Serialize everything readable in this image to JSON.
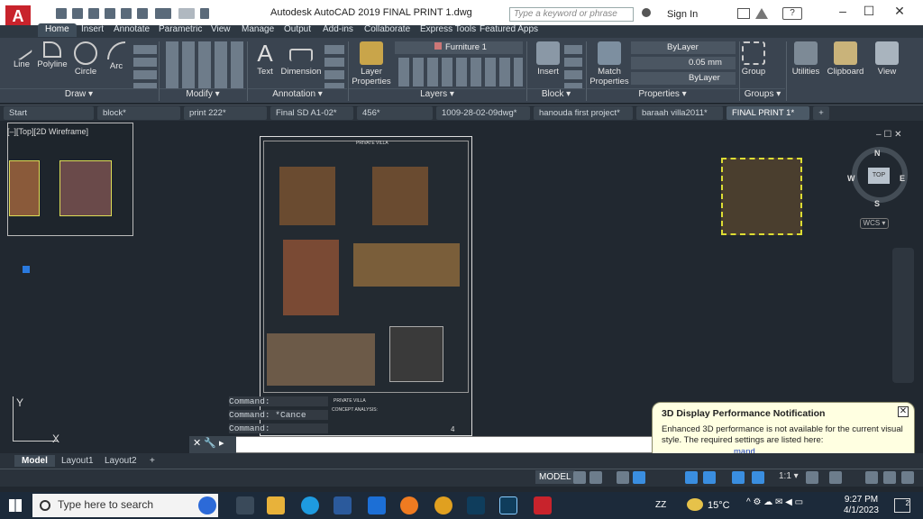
{
  "app": {
    "logo_letter": "A",
    "title": "Autodesk AutoCAD 2019    FINAL PRINT 1.dwg"
  },
  "search": {
    "placeholder": "Type a keyword or phrase"
  },
  "signin": {
    "label": "Sign In"
  },
  "window": {
    "min": "–",
    "max": "☐",
    "close": "✕"
  },
  "ribbon_tabs": [
    "Home",
    "Insert",
    "Annotate",
    "Parametric",
    "View",
    "Manage",
    "Output",
    "Add-ins",
    "Collaborate",
    "Express Tools",
    "Featured Apps"
  ],
  "ribbon": {
    "draw": {
      "line": "Line",
      "polyline": "Polyline",
      "circle": "Circle",
      "arc": "Arc",
      "panel": "Draw ▾"
    },
    "modify": {
      "panel": "Modify ▾"
    },
    "annotation": {
      "text": "Text",
      "dimension": "Dimension",
      "panel": "Annotation ▾"
    },
    "layers": {
      "layer_props": "Layer\nProperties",
      "layer_name": "Furniture 1",
      "panel": "Layers ▾"
    },
    "block": {
      "insert": "Insert",
      "panel": "Block ▾"
    },
    "properties": {
      "match": "Match\nProperties",
      "color": "ByLayer",
      "lineweight": "0.05 mm",
      "linetype": "ByLayer",
      "panel": "Properties ▾"
    },
    "groups": {
      "group": "Group",
      "panel": "Groups ▾"
    },
    "utilities": "Utilities",
    "clipboard": "Clipboard",
    "view": "View"
  },
  "doc_tabs": [
    "Start",
    "block*",
    "print 222*",
    "Final SD A1-02*",
    "456*",
    "1009-28-02-09dwg*",
    "hanouda first project*",
    "baraah villa2011*",
    "FINAL PRINT 1*"
  ],
  "doc_tab_add": "+",
  "viewport_label": "[–][Top][2D Wireframe]",
  "sheet": {
    "header": "PRIVATE VILLA",
    "title_block": "PRIVATE VILLA",
    "concept_heading": "CONCEPT ANALYSIS:",
    "sheet_no": "4"
  },
  "command_history": [
    "Command:",
    "Command: *Cance",
    "Command:"
  ],
  "command_prompt": "",
  "nav": {
    "n": "N",
    "s": "S",
    "e": "E",
    "w": "W",
    "top": "TOP",
    "wcs": "WCS ▾"
  },
  "ucs": {
    "x": "X",
    "y": "Y"
  },
  "notification": {
    "title": "3D Display Performance Notification",
    "body": "Enhanced 3D performance is not available for the current visual style. The required settings are listed here:",
    "link": "mand"
  },
  "layout_tabs": [
    "Model",
    "Layout1",
    "Layout2"
  ],
  "layout_add": "+",
  "status": {
    "model": "MODEL",
    "scale": "1:1 ▾"
  },
  "taskbar": {
    "search": "Type here to search",
    "temp": "15°C",
    "time": "9:27 PM",
    "date": "4/1/2023",
    "zz": "ZZ",
    "notif_count": "2"
  },
  "colors": {
    "accent_red": "#c8232c",
    "ribbon_bg": "#3a4450",
    "canvas_bg": "#212830",
    "notif_bg": "#ffffe1",
    "taskbar": "#1c2a3a"
  }
}
